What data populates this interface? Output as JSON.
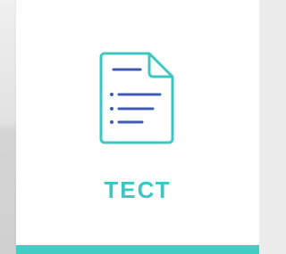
{
  "card": {
    "title": "ТЕСТ",
    "icon": "document-list-icon"
  },
  "colors": {
    "accent": "#43cdc7",
    "icon_outline": "#3cc7c2",
    "icon_lines": "#3f5bb0"
  }
}
